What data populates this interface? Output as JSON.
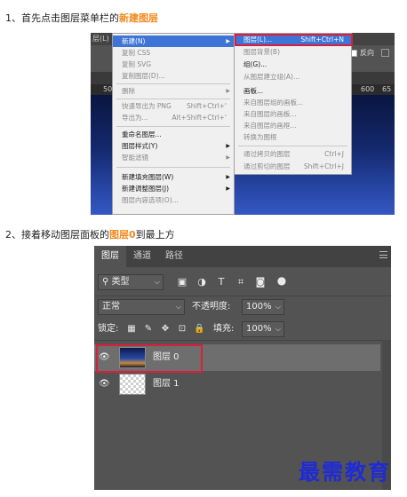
{
  "step1": {
    "prefix": "1、首先点击图层菜单栏的",
    "highlight": "新建图层"
  },
  "step2": {
    "prefix": "2、接着移动图层面板的",
    "highlight": "图层0",
    "suffix": "到最上方"
  },
  "ps": {
    "topbar_text": "层(L)",
    "options": {
      "label": "反向"
    },
    "ruler": [
      "50",
      "600",
      "65"
    ]
  },
  "layer_menu": {
    "items": [
      {
        "label": "新建(N)",
        "state": "selected",
        "arrow": true
      },
      {
        "label": "复制 CSS",
        "state": "disabled"
      },
      {
        "label": "复制 SVG",
        "state": "disabled"
      },
      {
        "label": "复制图层(D)...",
        "state": "disabled"
      },
      {
        "label": "删除",
        "state": "disabled",
        "arrow": true
      },
      {
        "label": "快速导出为 PNG",
        "shortcut": "Shift+Ctrl+'",
        "state": "disabled"
      },
      {
        "label": "导出为...",
        "shortcut": "Alt+Shift+Ctrl+'",
        "state": "disabled"
      },
      {
        "label": "重命名图层...",
        "state": "normal"
      },
      {
        "label": "图层样式(Y)",
        "state": "normal",
        "arrow": true
      },
      {
        "label": "智能滤镜",
        "state": "disabled",
        "arrow": true
      },
      {
        "label": "新建填充图层(W)",
        "state": "normal",
        "arrow": true
      },
      {
        "label": "新建调整图层(J)",
        "state": "normal",
        "arrow": true
      },
      {
        "label": "图层内容选项(O)...",
        "state": "disabled"
      }
    ]
  },
  "new_submenu": {
    "items": [
      {
        "label": "图层(L)...",
        "shortcut": "Shift+Ctrl+N",
        "state": "selected"
      },
      {
        "label": "图层背景(B)",
        "state": "disabled"
      },
      {
        "label": "组(G)...",
        "state": "normal"
      },
      {
        "label": "从图层建立组(A)...",
        "state": "disabled"
      },
      {
        "label": "画板...",
        "state": "normal"
      },
      {
        "label": "来自图层组的画板...",
        "state": "disabled"
      },
      {
        "label": "来自图层的画板...",
        "state": "disabled"
      },
      {
        "label": "来自图层的画框...",
        "state": "disabled"
      },
      {
        "label": "转换为图框",
        "state": "disabled"
      },
      {
        "label": "通过拷贝的图层",
        "shortcut": "Ctrl+J",
        "state": "disabled"
      },
      {
        "label": "通过剪切的图层",
        "shortcut": "Shift+Ctrl+J",
        "state": "disabled"
      }
    ]
  },
  "layers_panel": {
    "tabs": [
      "图层",
      "通道",
      "路径"
    ],
    "filter": {
      "label": "类型"
    },
    "blend_mode": "正常",
    "opacity_label": "不透明度:",
    "opacity_value": "100%",
    "lock_label": "锁定:",
    "fill_label": "填充:",
    "fill_value": "100%",
    "layers": [
      {
        "name": "图层 0",
        "visible": true,
        "selected": true
      },
      {
        "name": "图层 1",
        "visible": true,
        "selected": false
      }
    ]
  },
  "watermark": "最需教育",
  "colors": {
    "highlight_text": "#f08a1c",
    "annotation_border": "#d8203a",
    "menu_selected": "#3d74d6",
    "watermark": "#1e2bd6"
  }
}
